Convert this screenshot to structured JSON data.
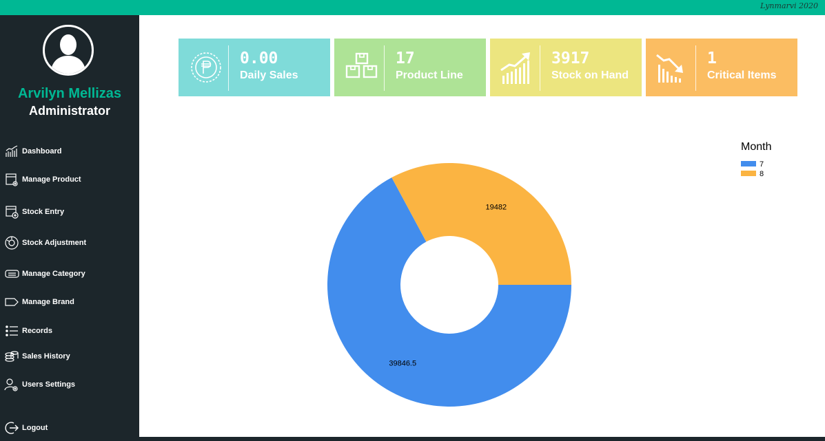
{
  "header": {
    "signature": "Lynmarvi 2020",
    "accent": "#00b894"
  },
  "user": {
    "name": "Arvilyn Mellizas",
    "role": "Administrator"
  },
  "nav": {
    "items": [
      {
        "label": "Dashboard",
        "icon": "chart-bars-icon"
      },
      {
        "label": "Manage Product",
        "icon": "product-gear-icon"
      },
      {
        "label": "Stock Entry",
        "icon": "stock-add-icon"
      },
      {
        "label": "Stock Adjustment",
        "icon": "adjust-dial-icon"
      },
      {
        "label": "Manage Category",
        "icon": "category-tag-icon"
      },
      {
        "label": "Manage Brand",
        "icon": "brand-label-icon"
      },
      {
        "label": "Records",
        "icon": "list-icon"
      },
      {
        "label": "Sales History",
        "icon": "coins-stack-icon"
      },
      {
        "label": "Users Settings",
        "icon": "user-gear-icon"
      },
      {
        "label": "Logout",
        "icon": "logout-icon"
      }
    ]
  },
  "cards": [
    {
      "value": "0.00",
      "label": "Daily Sales",
      "color": "#7fdbd9",
      "icon": "peso-coin-icon"
    },
    {
      "value": "17",
      "label": "Product Line",
      "color": "#aee396",
      "icon": "boxes-icon"
    },
    {
      "value": "3917",
      "label": "Stock on Hand",
      "color": "#ece57f",
      "icon": "rising-bars-icon"
    },
    {
      "value": "1",
      "label": "Critical Items",
      "color": "#fbbd62",
      "icon": "falling-bars-icon"
    }
  ],
  "chart_data": {
    "type": "pie",
    "donut": true,
    "legend_title": "Month",
    "legend_position": "top-right",
    "labels": [
      "7",
      "8"
    ],
    "values": [
      39846.5,
      19482
    ],
    "value_labels": [
      "39846.5",
      "19482"
    ],
    "colors": [
      "#428ded",
      "#fbb442"
    ]
  }
}
